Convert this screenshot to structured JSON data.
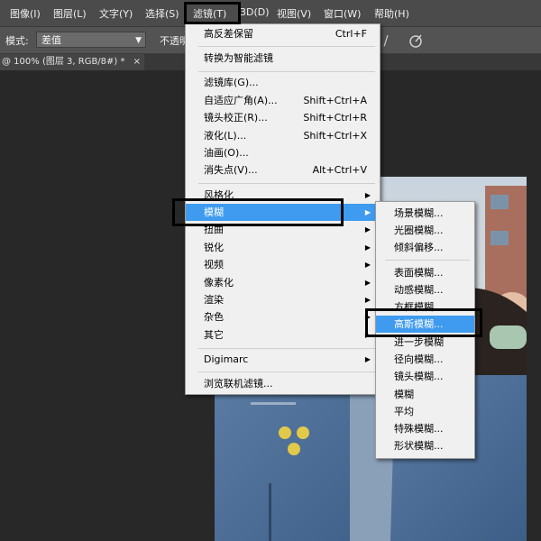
{
  "menubar": {
    "items": [
      "图像(I)",
      "图层(L)",
      "文字(Y)",
      "选择(S)",
      "滤镜(T)",
      "3D(D)",
      "视图(V)",
      "窗口(W)",
      "帮助(H)"
    ]
  },
  "options": {
    "mode_label": "模式:",
    "mode_value": "差值",
    "opacity_label": "不透明"
  },
  "document_tab": {
    "title": "@ 100% (图层 3, RGB/8#) *",
    "close": "×"
  },
  "filter_menu": {
    "items": [
      {
        "label": "高反差保留",
        "shortcut": "Ctrl+F"
      },
      {
        "label": "转换为智能滤镜",
        "shortcut": ""
      },
      {
        "label": "滤镜库(G)...",
        "shortcut": ""
      },
      {
        "label": "自适应广角(A)...",
        "shortcut": "Shift+Ctrl+A"
      },
      {
        "label": "镜头校正(R)...",
        "shortcut": "Shift+Ctrl+R"
      },
      {
        "label": "液化(L)...",
        "shortcut": "Shift+Ctrl+X"
      },
      {
        "label": "油画(O)...",
        "shortcut": ""
      },
      {
        "label": "消失点(V)...",
        "shortcut": "Alt+Ctrl+V"
      },
      {
        "label": "风格化"
      },
      {
        "label": "模糊"
      },
      {
        "label": "扭曲"
      },
      {
        "label": "锐化"
      },
      {
        "label": "视频"
      },
      {
        "label": "像素化"
      },
      {
        "label": "渲染"
      },
      {
        "label": "杂色"
      },
      {
        "label": "其它"
      },
      {
        "label": "Digimarc"
      },
      {
        "label": "浏览联机滤镜..."
      }
    ]
  },
  "blur_submenu": {
    "items": [
      "场景模糊...",
      "光圈模糊...",
      "倾斜偏移...",
      "表面模糊...",
      "动感模糊...",
      "方框模糊...",
      "高斯模糊...",
      "进一步模糊",
      "径向模糊...",
      "镜头模糊...",
      "模糊",
      "平均",
      "特殊模糊...",
      "形状模糊..."
    ]
  },
  "colors": {
    "highlight": "#3f9bef",
    "menu_bg": "#f0f0f0",
    "app_bg": "#282828"
  }
}
